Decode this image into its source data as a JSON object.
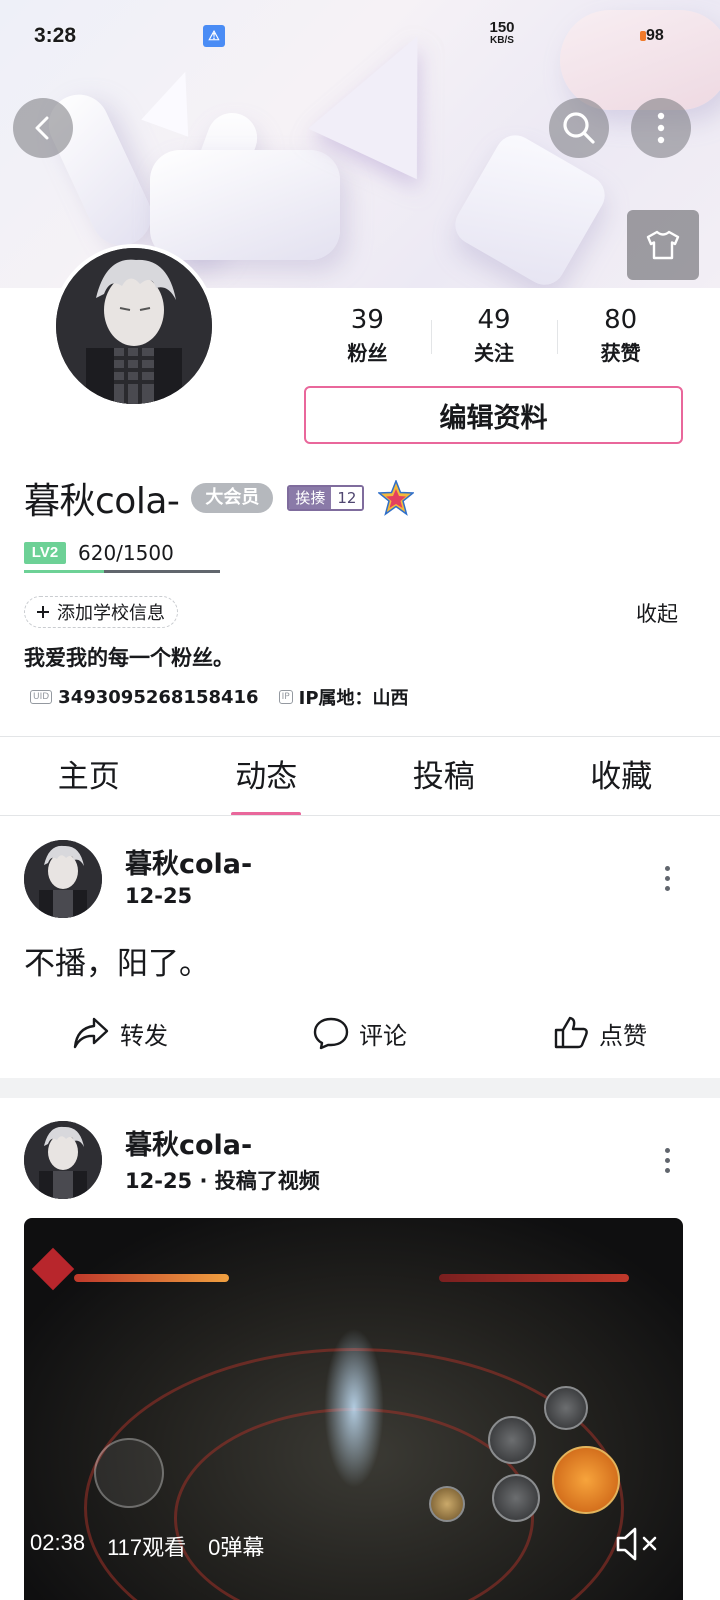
{
  "status_bar": {
    "time": "3:28",
    "net_speed": "150",
    "net_unit": "KB/S",
    "battery": "98"
  },
  "profile": {
    "stats": [
      {
        "value": "39",
        "label": "粉丝"
      },
      {
        "value": "49",
        "label": "关注"
      },
      {
        "value": "80",
        "label": "获赞"
      }
    ],
    "edit_label": "编辑资料",
    "username": "暮秋cola-",
    "vip_label": "大会员",
    "medal": {
      "name": "挨揍",
      "level": "12"
    },
    "level": {
      "tag": "LV2",
      "exp_text": "620/1500",
      "progress": 0.41
    },
    "school_label": "添加学校信息",
    "collapse_label": "收起",
    "signature": "我爱我的每一个粉丝。",
    "uid_tag": "UID",
    "uid": "3493095268158416",
    "ip_tag": "IP",
    "ip_location": "IP属地：山西"
  },
  "tabs": [
    {
      "label": "主页",
      "active": false
    },
    {
      "label": "动态",
      "active": true
    },
    {
      "label": "投稿",
      "active": false
    },
    {
      "label": "收藏",
      "active": false
    }
  ],
  "posts": [
    {
      "author": "暮秋cola-",
      "meta": "12-25",
      "text": "不播，阳了。",
      "actions": {
        "share": "转发",
        "comment": "评论",
        "like": "点赞"
      }
    },
    {
      "author": "暮秋cola-",
      "meta": "12-25 · 投稿了视频",
      "video": {
        "duration": "02:38",
        "views": "117观看",
        "danmaku": "0弹幕"
      }
    }
  ],
  "colors": {
    "accent_pink": "#e9679b",
    "level_green": "#6dd196",
    "vip_gray": "#b5b8bd"
  },
  "icons": [
    "back-icon",
    "search-icon",
    "more-icon",
    "tshirt-icon",
    "share-icon",
    "comment-icon",
    "like-icon",
    "mute-icon"
  ]
}
